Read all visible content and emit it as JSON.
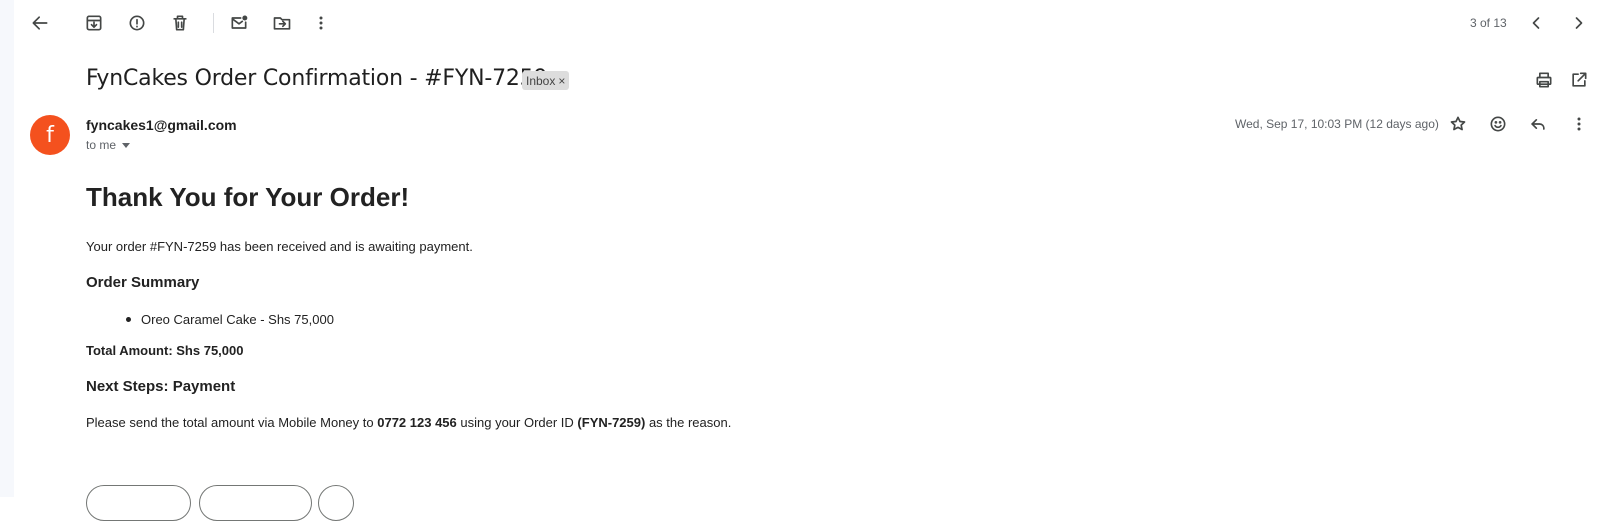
{
  "toolbar": {
    "page_count": "3 of 13"
  },
  "email": {
    "subject": "FynCakes Order Confirmation - #FYN-7259",
    "label_chip": "Inbox",
    "label_remove": "×",
    "sender_initial": "f",
    "sender": "fyncakes1@gmail.com",
    "recipient": "to me",
    "date": "Wed, Sep 17, 10:03 PM (12 days ago)"
  },
  "body": {
    "title": "Thank You for Your Order!",
    "intro": "Your order #FYN-7259 has been received and is awaiting payment.",
    "summary_heading": "Order Summary",
    "items": [
      "Oreo Caramel Cake - Shs 75,000"
    ],
    "total": "Total Amount: Shs 75,000",
    "next_heading": "Next Steps: Payment",
    "payment_prefix": "Please send the total amount via Mobile Money to ",
    "payment_number": "0772 123 456",
    "payment_middle": " using your Order ID ",
    "payment_order_id": "(FYN-7259)",
    "payment_suffix": " as the reason."
  },
  "colors": {
    "avatar": "#f4511e",
    "chip": "#dddddd",
    "rail": "#f6f8fc"
  }
}
